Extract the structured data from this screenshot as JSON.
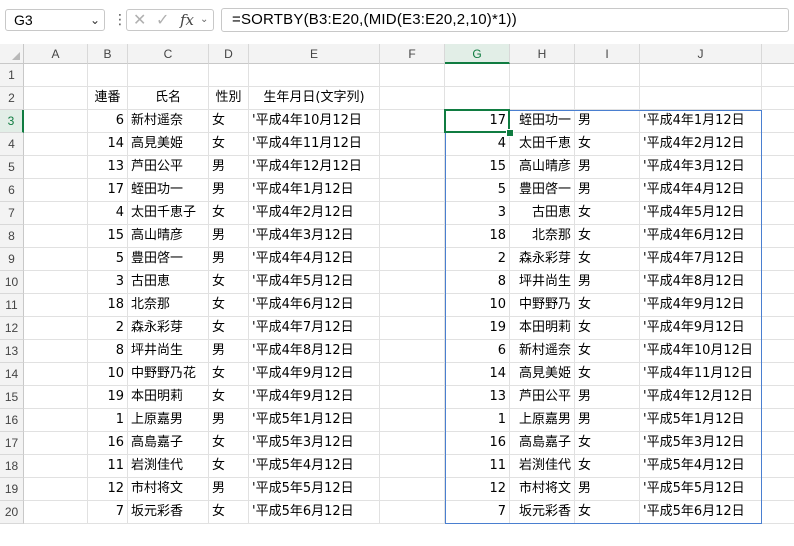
{
  "formula_bar": {
    "name_box": "G3",
    "name_box_arrow": "⌄",
    "dots": "⋮",
    "cancel_icon": "✕",
    "enter_icon": "✓",
    "fx_label": "fx",
    "expand_icon": "⌄",
    "formula": "=SORTBY(B3:E20,(MID(E3:E20,2,10)*1))"
  },
  "columns": [
    "A",
    "B",
    "C",
    "D",
    "E",
    "F",
    "G",
    "H",
    "I",
    "J"
  ],
  "selected_column": "G",
  "rows": [
    "1",
    "2",
    "3",
    "4",
    "5",
    "6",
    "7",
    "8",
    "9",
    "10",
    "11",
    "12",
    "13",
    "14",
    "15",
    "16",
    "17",
    "18",
    "19",
    "20"
  ],
  "selected_row": "3",
  "headers": {
    "b": "連番",
    "c": "氏名",
    "d": "性別",
    "e": "生年月日(文字列)"
  },
  "source_table": [
    {
      "b": "6",
      "c": "新村遥奈",
      "d": "女",
      "e": "'平成4年10月12日"
    },
    {
      "b": "14",
      "c": "高見美姫",
      "d": "女",
      "e": "'平成4年11月12日"
    },
    {
      "b": "13",
      "c": "芦田公平",
      "d": "男",
      "e": "'平成4年12月12日"
    },
    {
      "b": "17",
      "c": "蛭田功一",
      "d": "男",
      "e": "'平成4年1月12日"
    },
    {
      "b": "4",
      "c": "太田千恵子",
      "d": "女",
      "e": "'平成4年2月12日"
    },
    {
      "b": "15",
      "c": "高山晴彦",
      "d": "男",
      "e": "'平成4年3月12日"
    },
    {
      "b": "5",
      "c": "豊田啓一",
      "d": "男",
      "e": "'平成4年4月12日"
    },
    {
      "b": "3",
      "c": "古田恵",
      "d": "女",
      "e": "'平成4年5月12日"
    },
    {
      "b": "18",
      "c": "北奈那",
      "d": "女",
      "e": "'平成4年6月12日"
    },
    {
      "b": "2",
      "c": "森永彩芽",
      "d": "女",
      "e": "'平成4年7月12日"
    },
    {
      "b": "8",
      "c": "坪井尚生",
      "d": "男",
      "e": "'平成4年8月12日"
    },
    {
      "b": "10",
      "c": "中野野乃花",
      "d": "女",
      "e": "'平成4年9月12日"
    },
    {
      "b": "19",
      "c": "本田明莉",
      "d": "女",
      "e": "'平成4年9月12日"
    },
    {
      "b": "1",
      "c": "上原嘉男",
      "d": "男",
      "e": "'平成5年1月12日"
    },
    {
      "b": "16",
      "c": "高島嘉子",
      "d": "女",
      "e": "'平成5年3月12日"
    },
    {
      "b": "11",
      "c": "岩渕佳代",
      "d": "女",
      "e": "'平成5年4月12日"
    },
    {
      "b": "12",
      "c": "市村将文",
      "d": "男",
      "e": "'平成5年5月12日"
    },
    {
      "b": "7",
      "c": "坂元彩香",
      "d": "女",
      "e": "'平成5年6月12日"
    }
  ],
  "spill_table": [
    {
      "g": "17",
      "h": "蛭田功一",
      "i": "男",
      "j": "'平成4年1月12日"
    },
    {
      "g": "4",
      "h": "太田千恵",
      "i": "女",
      "j": "'平成4年2月12日"
    },
    {
      "g": "15",
      "h": "高山晴彦",
      "i": "男",
      "j": "'平成4年3月12日"
    },
    {
      "g": "5",
      "h": "豊田啓一",
      "i": "男",
      "j": "'平成4年4月12日"
    },
    {
      "g": "3",
      "h": "古田恵",
      "i": "女",
      "j": "'平成4年5月12日"
    },
    {
      "g": "18",
      "h": "北奈那",
      "i": "女",
      "j": "'平成4年6月12日"
    },
    {
      "g": "2",
      "h": "森永彩芽",
      "i": "女",
      "j": "'平成4年7月12日"
    },
    {
      "g": "8",
      "h": "坪井尚生",
      "i": "男",
      "j": "'平成4年8月12日"
    },
    {
      "g": "10",
      "h": "中野野乃",
      "i": "女",
      "j": "'平成4年9月12日"
    },
    {
      "g": "19",
      "h": "本田明莉",
      "i": "女",
      "j": "'平成4年9月12日"
    },
    {
      "g": "6",
      "h": "新村遥奈",
      "i": "女",
      "j": "'平成4年10月12日"
    },
    {
      "g": "14",
      "h": "高見美姫",
      "i": "女",
      "j": "'平成4年11月12日"
    },
    {
      "g": "13",
      "h": "芦田公平",
      "i": "男",
      "j": "'平成4年12月12日"
    },
    {
      "g": "1",
      "h": "上原嘉男",
      "i": "男",
      "j": "'平成5年1月12日"
    },
    {
      "g": "16",
      "h": "高島嘉子",
      "i": "女",
      "j": "'平成5年3月12日"
    },
    {
      "g": "11",
      "h": "岩渕佳代",
      "i": "女",
      "j": "'平成5年4月12日"
    },
    {
      "g": "12",
      "h": "市村将文",
      "i": "男",
      "j": "'平成5年5月12日"
    },
    {
      "g": "7",
      "h": "坂元彩香",
      "i": "女",
      "j": "'平成5年6月12日"
    }
  ],
  "colors": {
    "selection_green": "#107c41",
    "spill_border_blue": "#4a7fd0",
    "header_bg": "#f3f3f3"
  }
}
